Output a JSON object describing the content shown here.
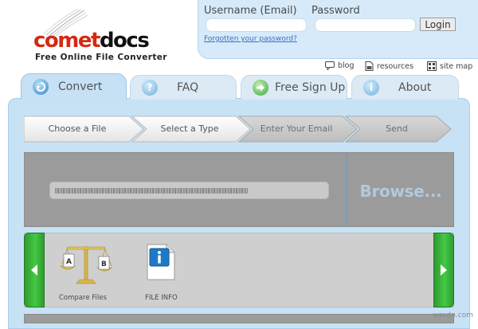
{
  "logo": {
    "part1": "comet",
    "part2": "docs",
    "tagline": "Free Online File Converter",
    "colors": {
      "red": "#d32a14",
      "dark": "#111111"
    }
  },
  "login": {
    "username_label": "Username (Email)",
    "password_label": "Password",
    "username_value": "",
    "password_value": "",
    "login_button": "Login",
    "forgot_link": "Forgotten your password?"
  },
  "util_links": [
    {
      "label": "blog",
      "icon": "chat-bubble-icon"
    },
    {
      "label": "resources",
      "icon": "document-icon"
    },
    {
      "label": "site map",
      "icon": "sitemap-icon"
    }
  ],
  "tabs": [
    {
      "label": "Convert",
      "icon": "convert-icon",
      "active": true
    },
    {
      "label": "FAQ",
      "icon": "question-icon",
      "active": false
    },
    {
      "label": "Free Sign Up",
      "icon": "signup-arrow-icon",
      "active": false
    },
    {
      "label": "About",
      "icon": "info-icon",
      "active": false
    }
  ],
  "steps": [
    {
      "label": "Choose a File",
      "state": "done"
    },
    {
      "label": "Select a Type",
      "state": "done"
    },
    {
      "label": "Enter Your Email",
      "state": "pending"
    },
    {
      "label": "Send",
      "state": "pending"
    }
  ],
  "upload": {
    "path_value": "",
    "browse_label": "Browse..."
  },
  "tools": [
    {
      "label": "Compare Files",
      "icon": "scale-icon"
    },
    {
      "label": "FILE INFO",
      "icon": "file-info-icon"
    }
  ],
  "watermark": "wsxdn.com",
  "colors": {
    "panel_bg": "#c7e2f5",
    "active_tab": "#c6e1f5",
    "green_button": "#3bb33b"
  }
}
